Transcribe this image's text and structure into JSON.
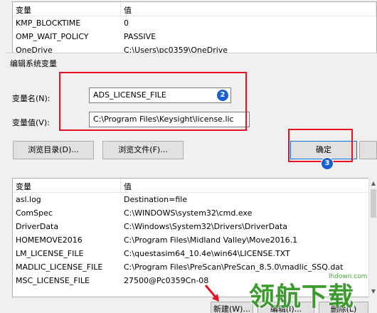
{
  "top_list": {
    "headers": [
      "变量",
      "值"
    ],
    "rows": [
      [
        "KMP_BLOCKTIME",
        "0"
      ],
      [
        "OMP_WAIT_POLICY",
        "PASSIVE"
      ],
      [
        "OneDrive",
        "C:\\Users\\pc0359\\OneDrive"
      ]
    ]
  },
  "dialog": {
    "title": "编辑系统变量",
    "name_label": "变量名(N):",
    "name_value": "ADS_LICENSE_FILE",
    "value_label": "变量值(V):",
    "value_value": "C:\\Program Files\\Keysight\\license.lic",
    "browse_dir": "浏览目录(D)...",
    "browse_file": "浏览文件(F)...",
    "ok": "确定"
  },
  "bottom_list": {
    "headers": [
      "变量",
      "值"
    ],
    "rows": [
      [
        "asl.log",
        "Destination=file"
      ],
      [
        "ComSpec",
        "C:\\WINDOWS\\system32\\cmd.exe"
      ],
      [
        "DriverData",
        "C:\\Windows\\System32\\Drivers\\DriverData"
      ],
      [
        "HOMEMOVE2016",
        "C:\\Program Files\\Midland Valley\\Move2016.1"
      ],
      [
        "LM_LICENSE_FILE",
        "C:\\questasim64_10.4e\\win64\\LICENSE.TXT"
      ],
      [
        "MADLIC_LICENSE_FILE",
        "C:\\Program Files\\PreScan\\PreScan_8.5.0\\madlic_SSQ.dat"
      ],
      [
        "MSC_LICENSE_FILE",
        "27500@Pc0359Cn-08"
      ]
    ]
  },
  "bottom_buttons": {
    "new": "新建(W)...",
    "edit": "编辑(I)...",
    "delete": "删除(L)"
  },
  "badges": {
    "b2": "2",
    "b3": "3"
  },
  "watermark": {
    "text": "领航下载",
    "url": "lhdown.com"
  },
  "colors": {
    "highlight": "#e81123",
    "badge": "#1a5fd0",
    "accent": "#0078d7"
  }
}
